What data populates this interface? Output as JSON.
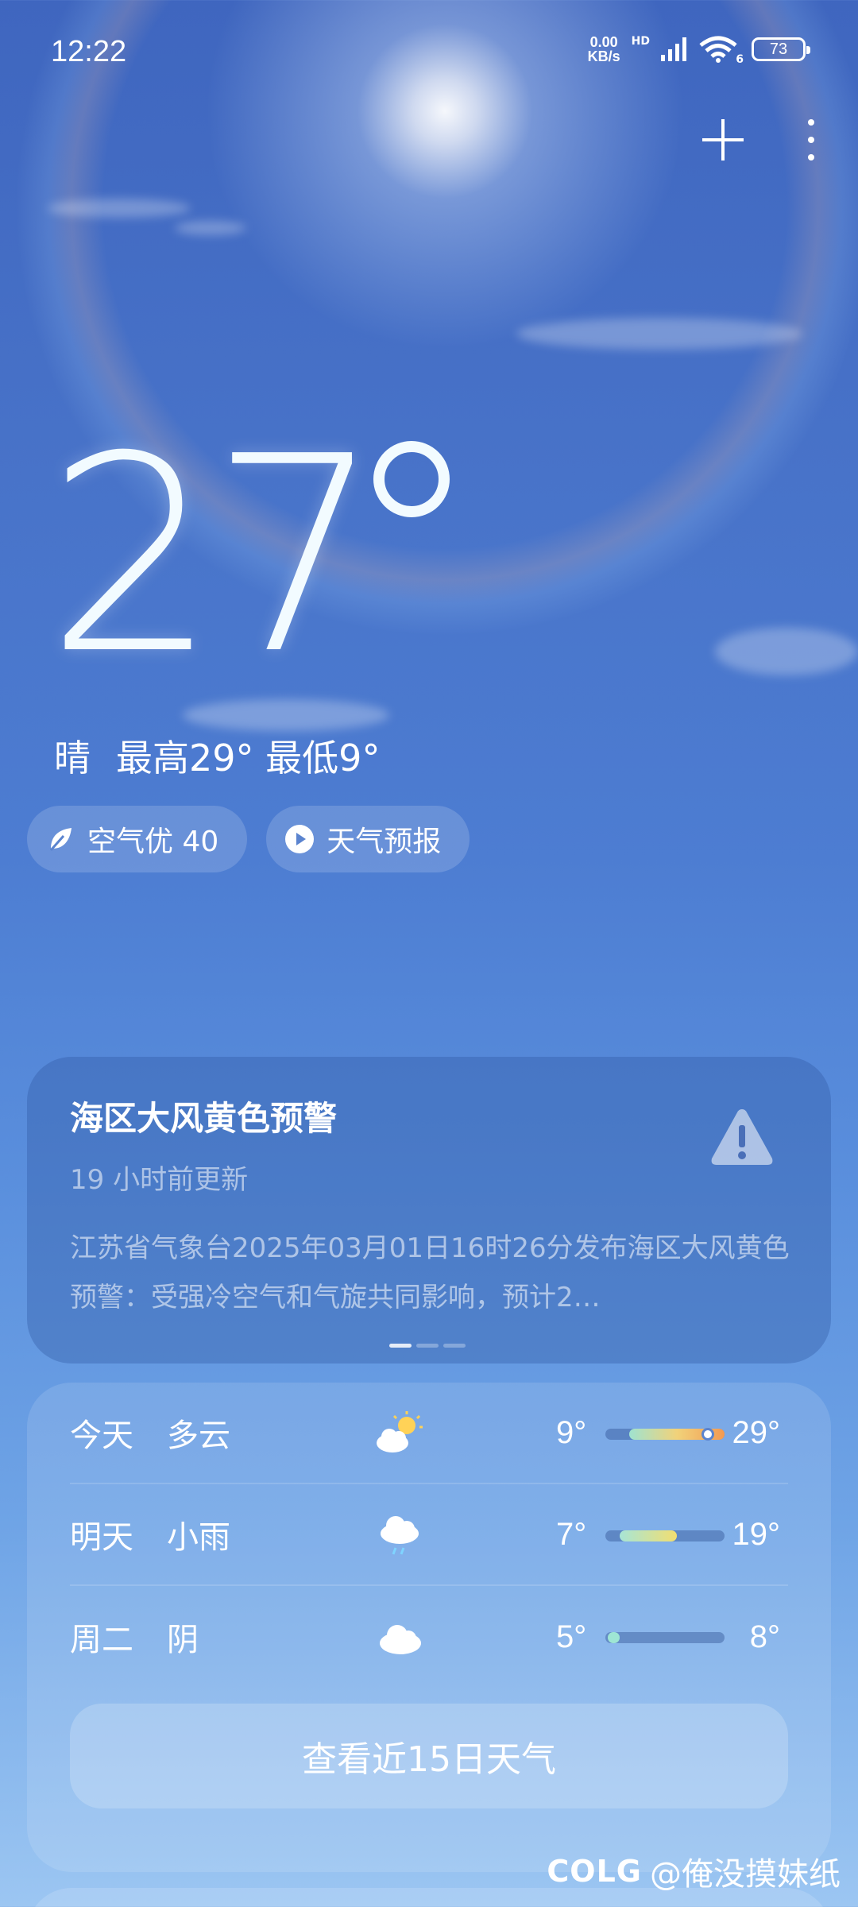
{
  "status_bar": {
    "time": "12:22",
    "net_speed_value": "0.00",
    "net_speed_unit": "KB/s",
    "net_label": "HD",
    "wifi_label": "6",
    "battery": "73"
  },
  "current": {
    "temperature": "27",
    "condition": "晴",
    "high": "最高29°",
    "low": "最低9°"
  },
  "chips": {
    "air_quality": "空气优 40",
    "forecast_video": "天气预报"
  },
  "alert": {
    "title": "海区大风黄色预警",
    "updated": "19 小时前更新",
    "body": "江苏省气象台2025年03月01日16时26分发布海区大风黄色预警：受强冷空气和气旋共同影响，预计2…",
    "page_count": 3,
    "active_page": 1
  },
  "forecast": {
    "days": [
      {
        "day": "今天",
        "condition": "多云",
        "icon": "partly-cloudy-icon",
        "low": "9°",
        "high": "29°",
        "fill_start": 0.2,
        "fill_end": 1.0,
        "marker": 0.86,
        "fill_color": "linear-gradient(90deg,#9fe3d0,#f1d27a,#f39a52)"
      },
      {
        "day": "明天",
        "condition": "小雨",
        "icon": "light-rain-icon",
        "low": "7°",
        "high": "19°",
        "fill_start": 0.12,
        "fill_end": 0.6,
        "marker": null,
        "fill_color": "linear-gradient(90deg,#a7e5d6,#f2de70)"
      },
      {
        "day": "周二",
        "condition": "阴",
        "icon": "overcast-icon",
        "low": "5°",
        "high": "8°",
        "fill_start": 0.02,
        "fill_end": 0.12,
        "marker": null,
        "fill_color": "#9ee6d4"
      }
    ],
    "more_button": "查看近15日天气"
  },
  "watermark": {
    "logo": "COLG",
    "handle": "@俺没摸妹纸"
  }
}
